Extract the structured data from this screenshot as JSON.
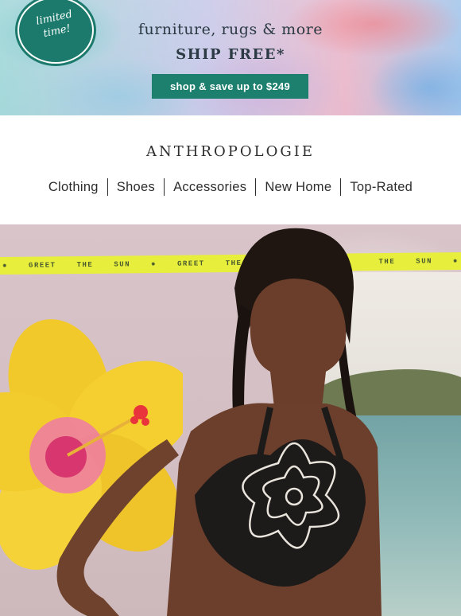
{
  "promo": {
    "badge": "limited time!",
    "line1": "furniture, rugs & more",
    "line2": "SHIP FREE*",
    "cta": "shop & save up to $249"
  },
  "brand": "ANTHROPOLOGIE",
  "nav": [
    "Clothing",
    "Shoes",
    "Accessories",
    "New Home",
    "Top-Rated"
  ],
  "hero": {
    "ribbon": [
      "GREET",
      "THE",
      "SUN",
      "GREET",
      "THE",
      "THE",
      "SUN"
    ],
    "ribbon_icon": "sun-icon"
  },
  "colors": {
    "cta_green": "#1d7f6d",
    "badge_green": "#1b7a6b",
    "ribbon_yellow": "#e7ef3c",
    "text_dark": "#2d2d2d"
  }
}
